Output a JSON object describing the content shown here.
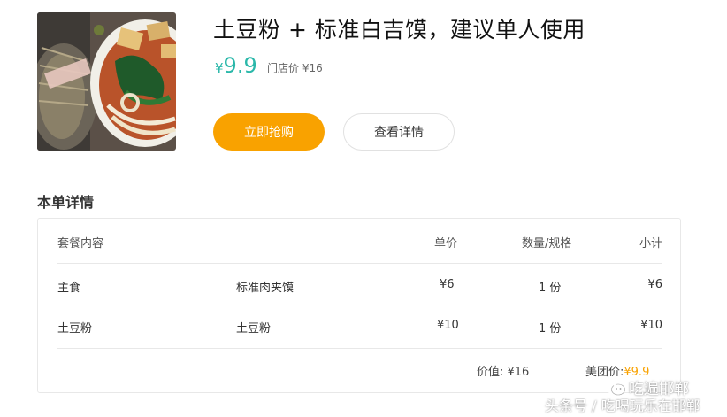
{
  "product": {
    "title": "土豆粉 + 标准白吉馍，建议单人使用",
    "price_symbol": "¥",
    "price": "9.9",
    "store_price": "门店价 ¥16",
    "image_icon": "noodle-soup-photo"
  },
  "actions": {
    "buy_label": "立即抢购",
    "details_label": "查看详情"
  },
  "details": {
    "section_title": "本单详情",
    "columns": [
      "套餐内容",
      "单价",
      "数量/规格",
      "小计"
    ],
    "rows": [
      {
        "category": "主食",
        "item": "标准肉夹馍",
        "unit_price": "¥6",
        "qty": "1 份",
        "subtotal": "¥6"
      },
      {
        "category": "土豆粉",
        "item": "土豆粉",
        "unit_price": "¥10",
        "qty": "1 份",
        "subtotal": "¥10"
      }
    ],
    "value_label": "价值: ¥16",
    "meituan_label": "美团价:",
    "meituan_price": "¥9.9"
  },
  "watermark": {
    "icon": "wechat-public-account-icon",
    "account": "吃遍邯郸",
    "credit": "头条号 / 吃喝玩乐在邯郸"
  },
  "colors": {
    "accent_orange": "#f9a200",
    "price_teal": "#2bb8aa"
  }
}
